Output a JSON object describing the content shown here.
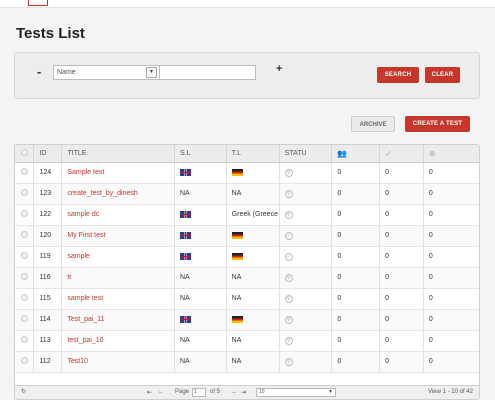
{
  "page": {
    "title": "Tests List"
  },
  "filter": {
    "minus": "-",
    "plus": "+",
    "field": "Name",
    "value": "",
    "search_label": "SEARCH",
    "clear_label": "CLEAR"
  },
  "actions": {
    "archive_label": "ARCHIVE",
    "create_label": "CREATE A TEST"
  },
  "table": {
    "headers": [
      "ID",
      "TITLE",
      "S.L",
      "T.L",
      "STATU"
    ],
    "rows": [
      {
        "id": "124",
        "title": "Sample test",
        "sl": "uk-flag",
        "tl": "de-flag",
        "status": "lock",
        "c1": "0",
        "c2": "0",
        "c3": "0"
      },
      {
        "id": "123",
        "title": "create_test_by_dinesh",
        "sl": "NA",
        "tl": "NA",
        "status": "lock",
        "c1": "0",
        "c2": "0",
        "c3": "0"
      },
      {
        "id": "122",
        "title": "sample dc",
        "sl": "uk-flag",
        "tl": "Greek (Greece",
        "status": "lock",
        "c1": "0",
        "c2": "0",
        "c3": "0"
      },
      {
        "id": "120",
        "title": "My First test",
        "sl": "uk-flag",
        "tl": "de-flag",
        "status": "check",
        "c1": "0",
        "c2": "0",
        "c3": "0"
      },
      {
        "id": "119",
        "title": "sample",
        "sl": "uk-flag",
        "tl": "de-flag",
        "status": "check",
        "c1": "0",
        "c2": "0",
        "c3": "0"
      },
      {
        "id": "116",
        "title": "tr",
        "sl": "NA",
        "tl": "NA",
        "status": "lock",
        "c1": "0",
        "c2": "0",
        "c3": "0"
      },
      {
        "id": "115",
        "title": "sample test",
        "sl": "NA",
        "tl": "NA",
        "status": "lock",
        "c1": "0",
        "c2": "0",
        "c3": "0"
      },
      {
        "id": "114",
        "title": "Test_pai_11",
        "sl": "uk-flag",
        "tl": "de-flag",
        "status": "lock",
        "c1": "0",
        "c2": "0",
        "c3": "0"
      },
      {
        "id": "113",
        "title": "test_pai_10",
        "sl": "NA",
        "tl": "NA",
        "status": "lock",
        "c1": "0",
        "c2": "0",
        "c3": "0"
      },
      {
        "id": "112",
        "title": "Test10",
        "sl": "NA",
        "tl": "NA",
        "status": "lock",
        "c1": "0",
        "c2": "0",
        "c3": "0"
      }
    ]
  },
  "pager": {
    "page_label": "Page",
    "page_value": "1",
    "of_label": "of 5",
    "per_page": "10",
    "view_text": "View 1 - 10 of 42"
  },
  "colors": {
    "accent": "#c7362b"
  }
}
